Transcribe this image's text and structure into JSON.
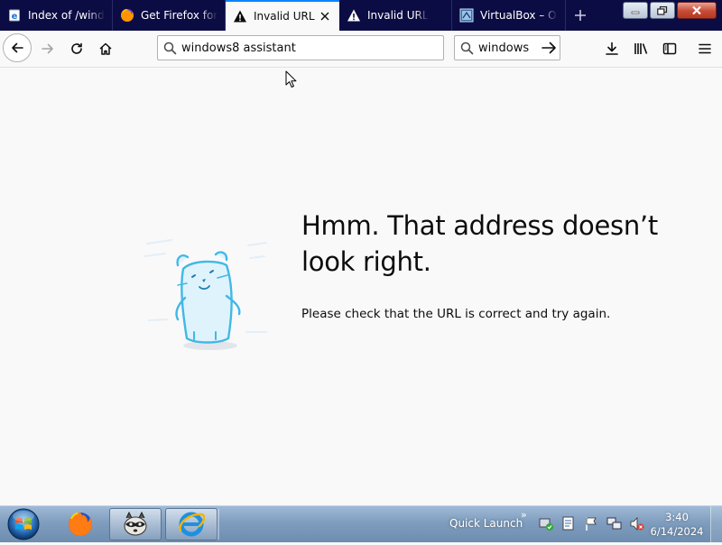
{
  "browser": {
    "tabs": [
      {
        "label": "Index of /windows",
        "icon": "ie-page-icon",
        "active": false
      },
      {
        "label": "Get Firefox for m",
        "icon": "firefox-icon",
        "active": false
      },
      {
        "label": "Invalid URL",
        "icon": "warning-icon",
        "active": true
      },
      {
        "label": "Invalid URL",
        "icon": "warning-icon",
        "active": false
      },
      {
        "label": "VirtualBox – Ora",
        "icon": "virtualbox-icon",
        "active": false
      }
    ],
    "accent_color": "#0a84ff",
    "tab_strip_color": "#0c0c44"
  },
  "navbar": {
    "url_value": "windows8 assistant",
    "search_value": "windows"
  },
  "error_page": {
    "title": "Hmm. That address doesn’t look right.",
    "description": "Please check that the URL is correct and try again."
  },
  "taskbar": {
    "quick_launch_label": "Quick Launch",
    "clock_time": "3:40",
    "clock_date": "6/14/2024"
  }
}
